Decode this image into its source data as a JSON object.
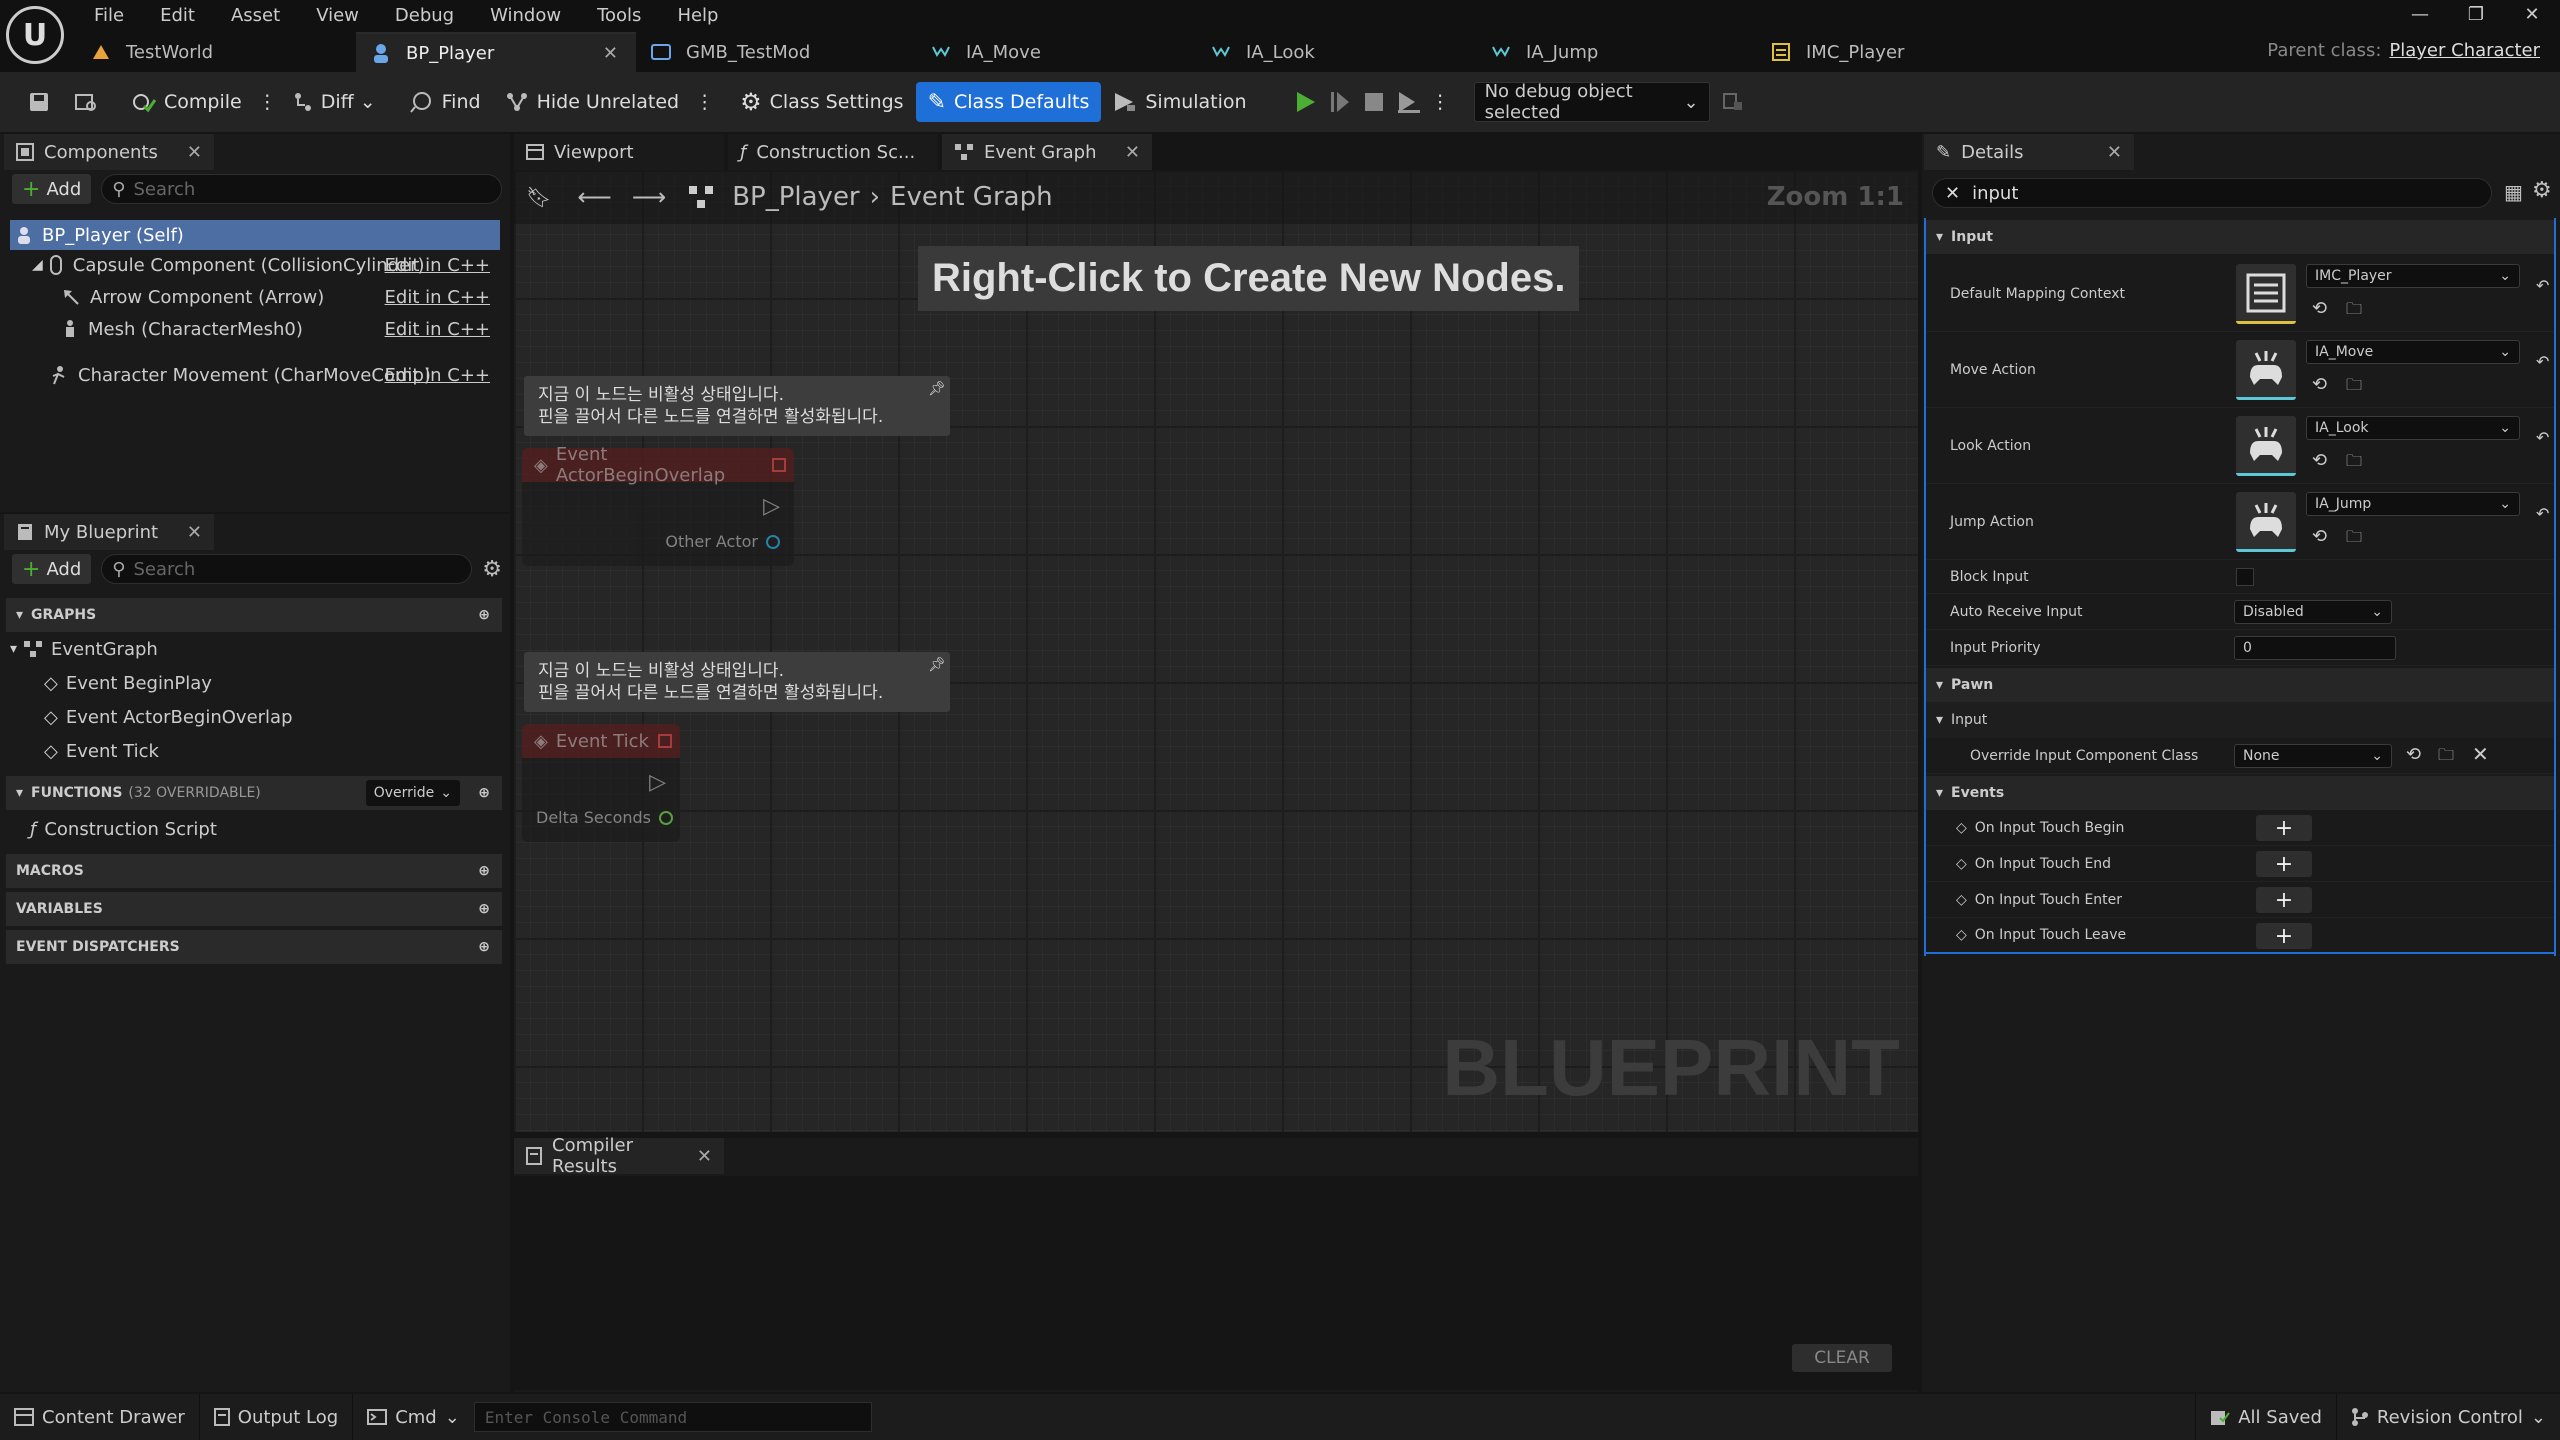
{
  "menu": [
    "File",
    "Edit",
    "Asset",
    "View",
    "Debug",
    "Window",
    "Tools",
    "Help"
  ],
  "doc_tabs": [
    {
      "label": "TestWorld",
      "icon": "level-icon"
    },
    {
      "label": "BP_Player",
      "icon": "blueprint-icon",
      "active": true
    },
    {
      "label": "GMB_TestMod",
      "icon": "gameplay-module-icon"
    },
    {
      "label": "IA_Move",
      "icon": "input-action-icon"
    },
    {
      "label": "IA_Look",
      "icon": "input-action-icon"
    },
    {
      "label": "IA_Jump",
      "icon": "input-action-icon"
    },
    {
      "label": "IMC_Player",
      "icon": "mapping-context-icon"
    }
  ],
  "parent_class": {
    "label": "Parent class:",
    "value": "Player Character"
  },
  "toolbar": {
    "compile": "Compile",
    "diff": "Diff",
    "find": "Find",
    "hide_unrelated": "Hide Unrelated",
    "class_settings": "Class Settings",
    "class_defaults": "Class Defaults",
    "simulation": "Simulation",
    "debug_select": "No debug object selected"
  },
  "components": {
    "title": "Components",
    "add": "Add",
    "search_placeholder": "Search",
    "items": [
      {
        "label": "BP_Player (Self)",
        "edit": ""
      },
      {
        "label": "Capsule Component (CollisionCylinder)",
        "edit": "Edit in C++"
      },
      {
        "label": "Arrow Component (Arrow)",
        "edit": "Edit in C++"
      },
      {
        "label": "Mesh (CharacterMesh0)",
        "edit": "Edit in C++"
      },
      {
        "label": "Character Movement (CharMoveComp)",
        "edit": "Edit in C++"
      }
    ]
  },
  "my_blueprint": {
    "title": "My Blueprint",
    "add": "Add",
    "search_placeholder": "Search",
    "graphs_label": "GRAPHS",
    "event_graph": "EventGraph",
    "events": [
      "Event BeginPlay",
      "Event ActorBeginOverlap",
      "Event Tick"
    ],
    "functions_label": "FUNCTIONS",
    "functions_count": "(32 OVERRIDABLE)",
    "override": "Override",
    "construction_script": "Construction Script",
    "macros": "MACROS",
    "variables": "VARIABLES",
    "dispatchers": "EVENT DISPATCHERS"
  },
  "graph_tabs": [
    {
      "label": "Viewport"
    },
    {
      "label": "Construction Sc..."
    },
    {
      "label": "Event Graph"
    }
  ],
  "graph": {
    "breadcrumb_root": "BP_Player",
    "breadcrumb_leaf": "Event Graph",
    "zoom": "Zoom 1:1",
    "hint": "Right-Click to Create New Nodes.",
    "watermark": "BLUEPRINT",
    "comment_line1": "지금 이 노드는 비활성 상태입니다.",
    "comment_line2": "핀을 끌어서 다른 노드를 연결하면 활성화됩니다.",
    "node_overlap": "Event ActorBeginOverlap",
    "pin_other_actor": "Other Actor",
    "node_tick": "Event Tick",
    "pin_delta": "Delta Seconds"
  },
  "compiler": {
    "title": "Compiler Results",
    "clear": "CLEAR"
  },
  "details": {
    "title": "Details",
    "search_value": "input",
    "section_input": "Input",
    "rows": [
      {
        "label": "Default Mapping Context",
        "value": "IMC_Player"
      },
      {
        "label": "Move Action",
        "value": "IA_Move"
      },
      {
        "label": "Look Action",
        "value": "IA_Look"
      },
      {
        "label": "Jump Action",
        "value": "IA_Jump"
      }
    ],
    "block_input": "Block Input",
    "auto_receive": "Auto Receive Input",
    "auto_receive_value": "Disabled",
    "input_priority": "Input Priority",
    "input_priority_value": "0",
    "section_pawn": "Pawn",
    "sub_input": "Input",
    "override_input": "Override Input Component Class",
    "override_value": "None",
    "section_events": "Events",
    "events": [
      "On Input Touch Begin",
      "On Input Touch End",
      "On Input Touch Enter",
      "On Input Touch Leave"
    ]
  },
  "statusbar": {
    "content_drawer": "Content Drawer",
    "output_log": "Output Log",
    "cmd": "Cmd",
    "console_placeholder": "Enter Console Command",
    "all_saved": "All Saved",
    "revision": "Revision Control"
  },
  "colors": {
    "accent": "#1f6fd8",
    "play": "#4caf34"
  }
}
